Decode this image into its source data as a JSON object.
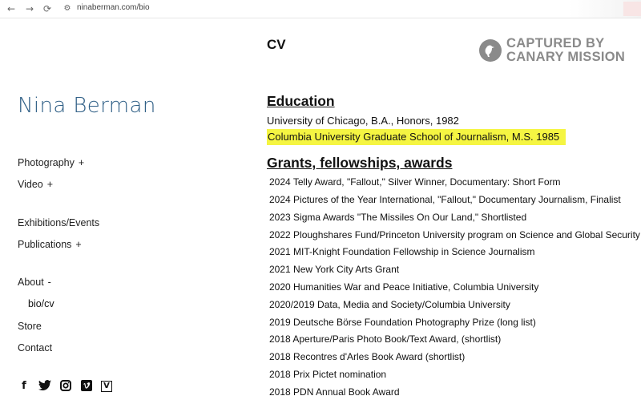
{
  "browser": {
    "back_icon": "←",
    "forward_icon": "→",
    "reload_icon": "⟳",
    "url": "ninaberman.com/bio"
  },
  "sidebar": {
    "site_title": "Nina Berman",
    "menu": [
      {
        "label": "Photography",
        "toggle": "+"
      },
      {
        "label": "Video",
        "toggle": "+"
      },
      {
        "label": "Exhibitions/Events",
        "toggle": ""
      },
      {
        "label": "Publications",
        "toggle": "+"
      },
      {
        "label": "About",
        "toggle": "-"
      },
      {
        "label": "bio/cv",
        "toggle": ""
      },
      {
        "label": "Store",
        "toggle": ""
      },
      {
        "label": "Contact",
        "toggle": ""
      }
    ],
    "social": [
      "facebook",
      "twitter",
      "instagram",
      "vimeo",
      "vine"
    ]
  },
  "main": {
    "title": "CV",
    "stamp": {
      "line1": "CAPTURED BY",
      "line2": "CANARY MISSION"
    },
    "education": {
      "heading": "Education",
      "items": [
        "University of Chicago, B.A., Honors, 1982",
        "Columbia University Graduate School of Journalism, M.S. 1985"
      ]
    },
    "grants": {
      "heading": "Grants, fellowships, awards",
      "items": [
        "2024 Telly Award, \"Fallout,\" Silver Winner, Documentary: Short Form",
        "2024 Pictures of the Year International,  \"Fallout,\" Documentary Journalism, Finalist",
        "2023 Sigma Awards \"The Missiles On Our Land,\" Shortlisted",
        "2022 Ploughshares Fund/Princeton University program on Science and Global Security",
        "2021 MIT-Knight Foundation Fellowship in Science Journalism",
        "2021 New York City Arts Grant",
        "2020 Humanities War and Peace Initiative, Columbia University",
        "2020/2019 Data, Media and Society/Columbia University",
        "2019 Deutsche Börse Foundation Photography Prize (long list)",
        "2018 Aperture/Paris Photo Book/Text Award, (shortlist)",
        "2018 Recontres d'Arles Book Award (shortlist)",
        "2018 Prix Pictet nomination",
        "2018 PDN Annual Book Award"
      ]
    }
  }
}
